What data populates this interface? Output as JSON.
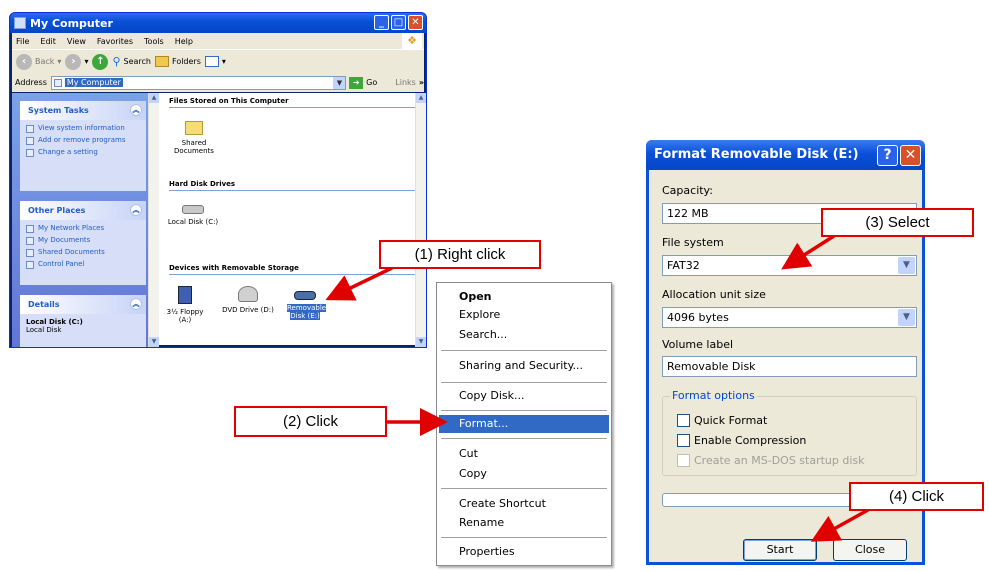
{
  "explorer": {
    "title": "My Computer",
    "menu": [
      "File",
      "Edit",
      "View",
      "Favorites",
      "Tools",
      "Help"
    ],
    "toolbar": {
      "back": "Back",
      "search": "Search",
      "folders": "Folders"
    },
    "address": {
      "label": "Address",
      "value": "My Computer",
      "go": "Go",
      "links": "Links"
    },
    "tasks": {
      "system": {
        "title": "System Tasks",
        "items": [
          "View system information",
          "Add or remove programs",
          "Change a setting"
        ]
      },
      "other": {
        "title": "Other Places",
        "items": [
          "My Network Places",
          "My Documents",
          "Shared Documents",
          "Control Panel"
        ]
      },
      "details": {
        "title": "Details",
        "name": "Local Disk (C:)",
        "type": "Local Disk"
      }
    },
    "groups": {
      "files": {
        "title": "Files Stored on This Computer",
        "items": [
          "Shared Documents"
        ]
      },
      "hdd": {
        "title": "Hard Disk Drives",
        "items": [
          "Local Disk (C:)"
        ]
      },
      "removable": {
        "title": "Devices with Removable Storage",
        "items": [
          "3½ Floppy (A:)",
          "DVD Drive (D:)",
          "Removable Disk (E:)"
        ]
      }
    }
  },
  "context_menu": {
    "items": [
      "Open",
      "Explore",
      "Search...",
      "Sharing and Security...",
      "Copy Disk...",
      "Format...",
      "Cut",
      "Copy",
      "Create Shortcut",
      "Rename",
      "Properties"
    ],
    "highlighted": "Format..."
  },
  "dialog": {
    "title": "Format Removable Disk (E:)",
    "capacity": {
      "label": "Capacity:",
      "value": "122 MB"
    },
    "file_system": {
      "label": "File system",
      "value": "FAT32"
    },
    "allocation": {
      "label": "Allocation unit size",
      "value": "4096 bytes"
    },
    "volume": {
      "label": "Volume label",
      "value": "Removable Disk"
    },
    "options": {
      "title": "Format options",
      "quick": "Quick Format",
      "compression": "Enable Compression",
      "msdos": "Create an MS-DOS startup disk"
    },
    "buttons": {
      "start": "Start",
      "close": "Close"
    }
  },
  "callouts": {
    "step1": "(1) Right click",
    "step2": "(2) Click",
    "step3": "(3) Select",
    "step4": "(4) Click"
  },
  "colors": {
    "callout_red": "#e00000",
    "xp_blue": "#0a50d8",
    "highlight": "#316ac5"
  }
}
